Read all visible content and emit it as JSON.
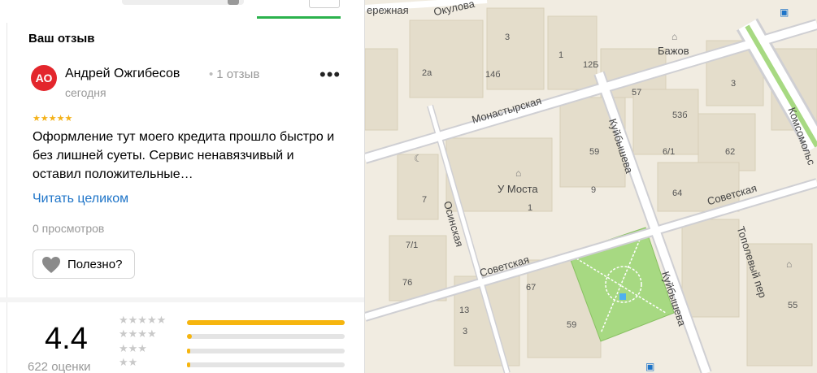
{
  "review": {
    "section_title": "Ваш отзыв",
    "avatar_initials": "АО",
    "author": "Андрей Ожгибесов",
    "review_count": "1 отзыв",
    "date": "сегодня",
    "stars": "★★★★★",
    "text": "Оформление тут моего кредита прошло быстро и без лишней суеты. Сервис ненавязчивый и оставил положительные…",
    "read_more": "Читать целиком",
    "views": "0 просмотров",
    "useful_label": "Полезно?"
  },
  "summary": {
    "rating": "4.4",
    "rating_count": "622 оценки",
    "bars": [
      {
        "stars": "★★★★★",
        "fraction": 1.0
      },
      {
        "stars": "★★★★",
        "fraction": 0.03
      },
      {
        "stars": "★★★",
        "fraction": 0.02
      },
      {
        "stars": "★★",
        "fraction": 0.02
      }
    ]
  },
  "map": {
    "streets": [
      "Окулова",
      "Монастырская",
      "Куйбышева",
      "Куйбышева",
      "Осинская",
      "Советская",
      "Советская",
      "Тополевый пер",
      "Комсомольс",
      "ережная"
    ],
    "places": [
      "Бажов",
      "У Моста"
    ],
    "house_numbers": [
      "3",
      "1",
      "12Б",
      "14б",
      "2а",
      "3",
      "57",
      "53б",
      "59",
      "6/1",
      "62",
      "64",
      "9",
      "7",
      "7/1",
      "76",
      "67",
      "13",
      "59",
      "55",
      "3",
      "1"
    ]
  },
  "colors": {
    "accent_green": "#2bb24c",
    "avatar_red": "#e3262c",
    "star_yellow": "#f4b118",
    "link_blue": "#1e74c8"
  }
}
